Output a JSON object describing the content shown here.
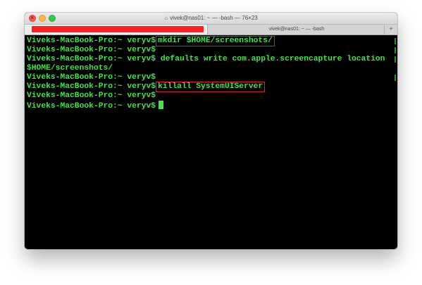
{
  "window": {
    "title": "vivek@nas01: ~ — -bash — 76×23",
    "title_icon": "home-folder-icon"
  },
  "tabs": [
    {
      "label": "",
      "active": true,
      "highlight_color": "#ff1f1f"
    },
    {
      "label": "vivek@nas01: ~ — -bash",
      "active": false
    }
  ],
  "terminal": {
    "text_color": "#3ee648",
    "background": "#000000",
    "prompt": "Viveks-MacBook-Pro:~ veryv$",
    "lines": [
      {
        "command": "mkdir $HOME/screenshots/"
      },
      {
        "command": ""
      },
      {
        "command": "defaults write com.apple.screencapture location"
      },
      {
        "continuation": "$HOME/screenshots/"
      },
      {
        "command": ""
      },
      {
        "command": "killall SystemUIServer"
      },
      {
        "command": ""
      },
      {
        "command": ""
      }
    ]
  }
}
